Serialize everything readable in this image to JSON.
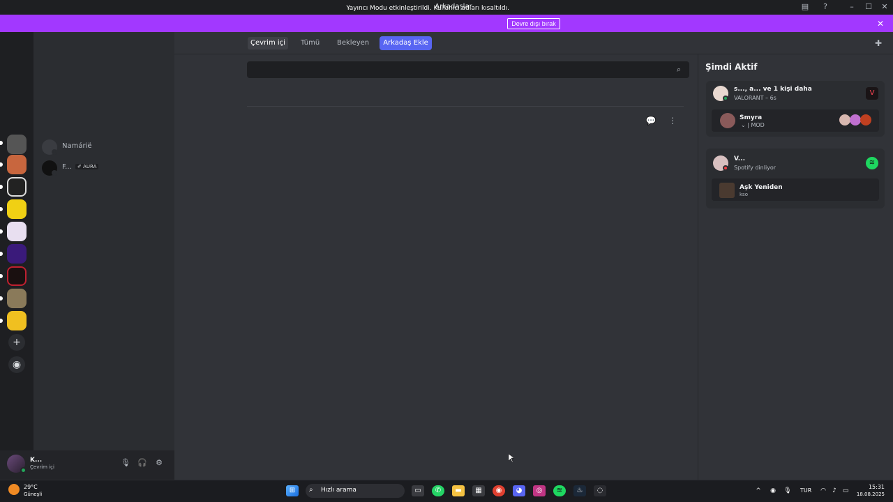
{
  "window": {
    "title": "Arkadaşlar"
  },
  "banner": {
    "text": "Yayıncı Modu etkinleştirildi. Kullanıcı adları kısaltıldı.",
    "button": "Devre dışı bırak"
  },
  "tabs": {
    "online": "Çevrim içi",
    "all": "Tümü",
    "pending": "Bekleyen",
    "add_friend": "Arkadaş Ekle"
  },
  "search": {
    "placeholder": ""
  },
  "dm_list": [
    {
      "name": "Namárië"
    },
    {
      "name": "F...",
      "tag": "AURA"
    }
  ],
  "user_panel": {
    "name": "K...",
    "status": "Çevrim içi"
  },
  "active_now": {
    "title": "Şimdi Aktif",
    "cards": [
      {
        "name": "s..., a... ve 1 kişi daha",
        "sub": "VALORANT – 6s",
        "inner_name": "Smyra",
        "inner_sub": "MOD"
      },
      {
        "name": "V...",
        "sub": "Spotify dinliyor",
        "inner_name": "Aşk Yeniden",
        "inner_sub": "kso"
      }
    ]
  },
  "taskbar": {
    "temp": "29°C",
    "weather": "Güneşli",
    "search": "Hızlı arama",
    "lang": "TUR",
    "time": "15:31",
    "date": "18.08.2025"
  },
  "colors": {
    "accent": "#5865f2",
    "banner": "#a238ff",
    "online": "#23a55a"
  }
}
